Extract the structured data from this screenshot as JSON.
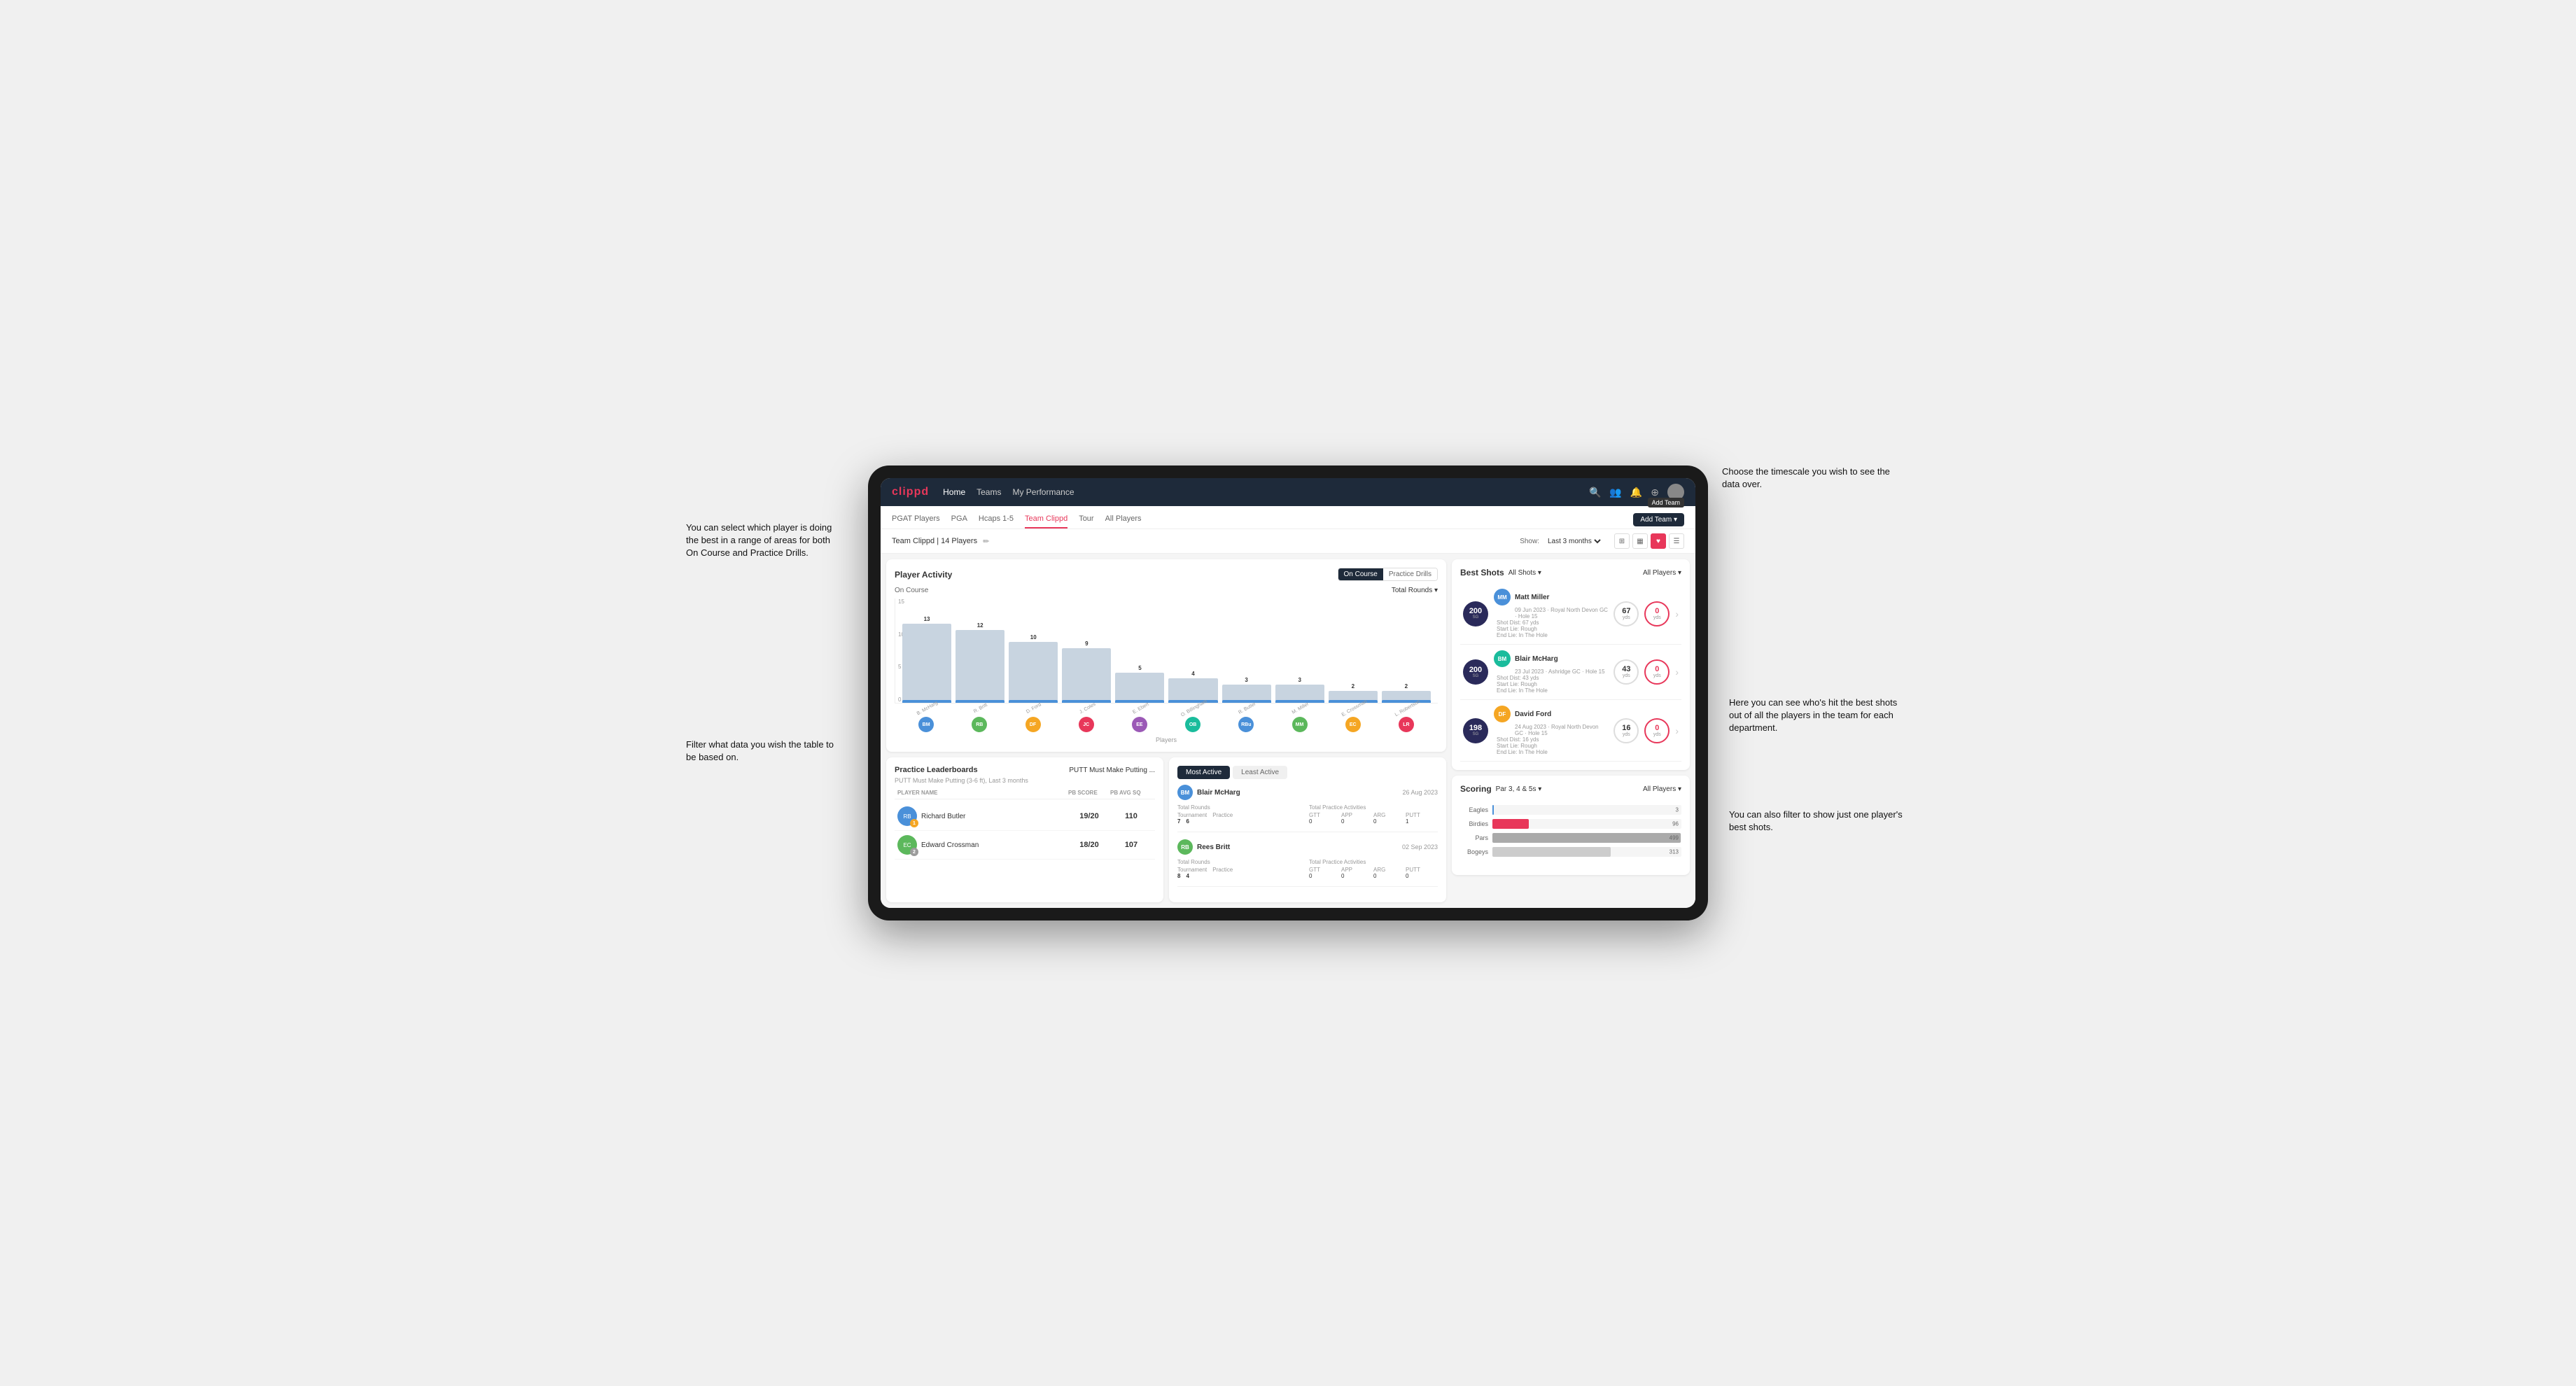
{
  "annotations": {
    "top_left": "You can select which player is doing the best in a range of areas for both On Course and Practice Drills.",
    "bottom_left": "Filter what data you wish the table to be based on.",
    "top_right": "Choose the timescale you wish to see the data over.",
    "middle_right": "Here you can see who's hit the best shots out of all the players in the team for each department.",
    "bottom_right": "You can also filter to show just one player's best shots."
  },
  "nav": {
    "logo": "clippd",
    "links": [
      "Home",
      "Teams",
      "My Performance"
    ],
    "icons": [
      "search",
      "users",
      "bell",
      "plus",
      "avatar"
    ]
  },
  "sub_nav": {
    "links": [
      "PGAT Players",
      "PGA",
      "Hcaps 1-5",
      "Team Clippd",
      "Tour",
      "All Players"
    ],
    "active": "Team Clippd",
    "add_button": "Add Team ▾",
    "tooltip": "Add Team"
  },
  "team_header": {
    "name": "Team Clippd | 14 Players",
    "edit_icon": "✏",
    "show_label": "Show:",
    "show_value": "Last 3 months",
    "view_icons": [
      "grid",
      "tiles",
      "heart",
      "list"
    ]
  },
  "player_activity": {
    "title": "Player Activity",
    "toggle": [
      "On Course",
      "Practice Drills"
    ],
    "active_toggle": "On Course",
    "subtitle": "On Course",
    "chart_filter": "Total Rounds ▾",
    "y_labels": [
      "15",
      "10",
      "5",
      "0"
    ],
    "bars": [
      {
        "name": "B. McHarg",
        "value": 13,
        "initials": "BM"
      },
      {
        "name": "R. Britt",
        "value": 12,
        "initials": "RB"
      },
      {
        "name": "D. Ford",
        "value": 10,
        "initials": "DF"
      },
      {
        "name": "J. Coles",
        "value": 9,
        "initials": "JC"
      },
      {
        "name": "E. Ebert",
        "value": 5,
        "initials": "EE"
      },
      {
        "name": "O. Billingham",
        "value": 4,
        "initials": "OB"
      },
      {
        "name": "R. Butler",
        "value": 3,
        "initials": "RBu"
      },
      {
        "name": "M. Miller",
        "value": 3,
        "initials": "MM"
      },
      {
        "name": "E. Crossman",
        "value": 2,
        "initials": "EC"
      },
      {
        "name": "L. Robertson",
        "value": 2,
        "initials": "LR"
      }
    ],
    "x_axis_label": "Players"
  },
  "practice_leaderboards": {
    "title": "Practice Leaderboards",
    "filter": "PUTT Must Make Putting ...",
    "subtitle": "PUTT Must Make Putting (3-6 ft), Last 3 months",
    "columns": [
      "PLAYER NAME",
      "PB SCORE",
      "PB AVG SQ"
    ],
    "players": [
      {
        "name": "Richard Butler",
        "rank": 1,
        "pb_score": "19/20",
        "pb_avg": "110",
        "initials": "RB"
      },
      {
        "name": "Edward Crossman",
        "rank": 2,
        "pb_score": "18/20",
        "pb_avg": "107",
        "initials": "EC"
      }
    ]
  },
  "most_active": {
    "tabs": [
      "Most Active",
      "Least Active"
    ],
    "active_tab": "Most Active",
    "players": [
      {
        "name": "Blair McHarg",
        "date": "26 Aug 2023",
        "initials": "BM",
        "total_rounds_label": "Total Rounds",
        "tournament": "7",
        "practice": "6",
        "practice_activities_label": "Total Practice Activities",
        "gtt": "0",
        "app": "0",
        "arg": "0",
        "putt": "1"
      },
      {
        "name": "Rees Britt",
        "date": "02 Sep 2023",
        "initials": "RB",
        "total_rounds_label": "Total Rounds",
        "tournament": "8",
        "practice": "4",
        "practice_activities_label": "Total Practice Activities",
        "gtt": "0",
        "app": "0",
        "arg": "0",
        "putt": "0"
      }
    ]
  },
  "best_shots": {
    "title": "Best Shots",
    "filter1": "All Shots ▾",
    "filter2": "All Players ▾",
    "shots": [
      {
        "player": "Matt Miller",
        "date": "09 Jun 2023 · Royal North Devon GC",
        "hole": "Hole 15",
        "badge_num": "200",
        "badge_label": "SG",
        "shot_dist": "Shot Dist: 67 yds",
        "start_lie": "Start Lie: Rough",
        "end_lie": "End Lie: In The Hole",
        "metric1_val": "67",
        "metric1_unit": "yds",
        "metric2_val": "0",
        "metric2_unit": "yds",
        "initials": "MM"
      },
      {
        "player": "Blair McHarg",
        "date": "23 Jul 2023 · Ashridge GC",
        "hole": "Hole 15",
        "badge_num": "200",
        "badge_label": "SG",
        "shot_dist": "Shot Dist: 43 yds",
        "start_lie": "Start Lie: Rough",
        "end_lie": "End Lie: In The Hole",
        "metric1_val": "43",
        "metric1_unit": "yds",
        "metric2_val": "0",
        "metric2_unit": "yds",
        "initials": "BM"
      },
      {
        "player": "David Ford",
        "date": "24 Aug 2023 · Royal North Devon GC",
        "hole": "Hole 15",
        "badge_num": "198",
        "badge_label": "SG",
        "shot_dist": "Shot Dist: 16 yds",
        "start_lie": "Start Lie: Rough",
        "end_lie": "End Lie: In The Hole",
        "metric1_val": "16",
        "metric1_unit": "yds",
        "metric2_val": "0",
        "metric2_unit": "yds",
        "initials": "DF"
      }
    ]
  },
  "scoring": {
    "title": "Scoring",
    "filter1": "Par 3, 4 & 5s ▾",
    "filter2": "All Players ▾",
    "rows": [
      {
        "label": "Eagles",
        "value": 3,
        "max": 500,
        "color": "eagles-fill"
      },
      {
        "label": "Birdies",
        "value": 96,
        "max": 500,
        "color": "birdies-fill"
      },
      {
        "label": "Pars",
        "value": 499,
        "max": 500,
        "color": "pars-fill"
      },
      {
        "label": "Bogeys",
        "value": 313,
        "max": 500,
        "color": "bogeys-fill"
      }
    ]
  }
}
